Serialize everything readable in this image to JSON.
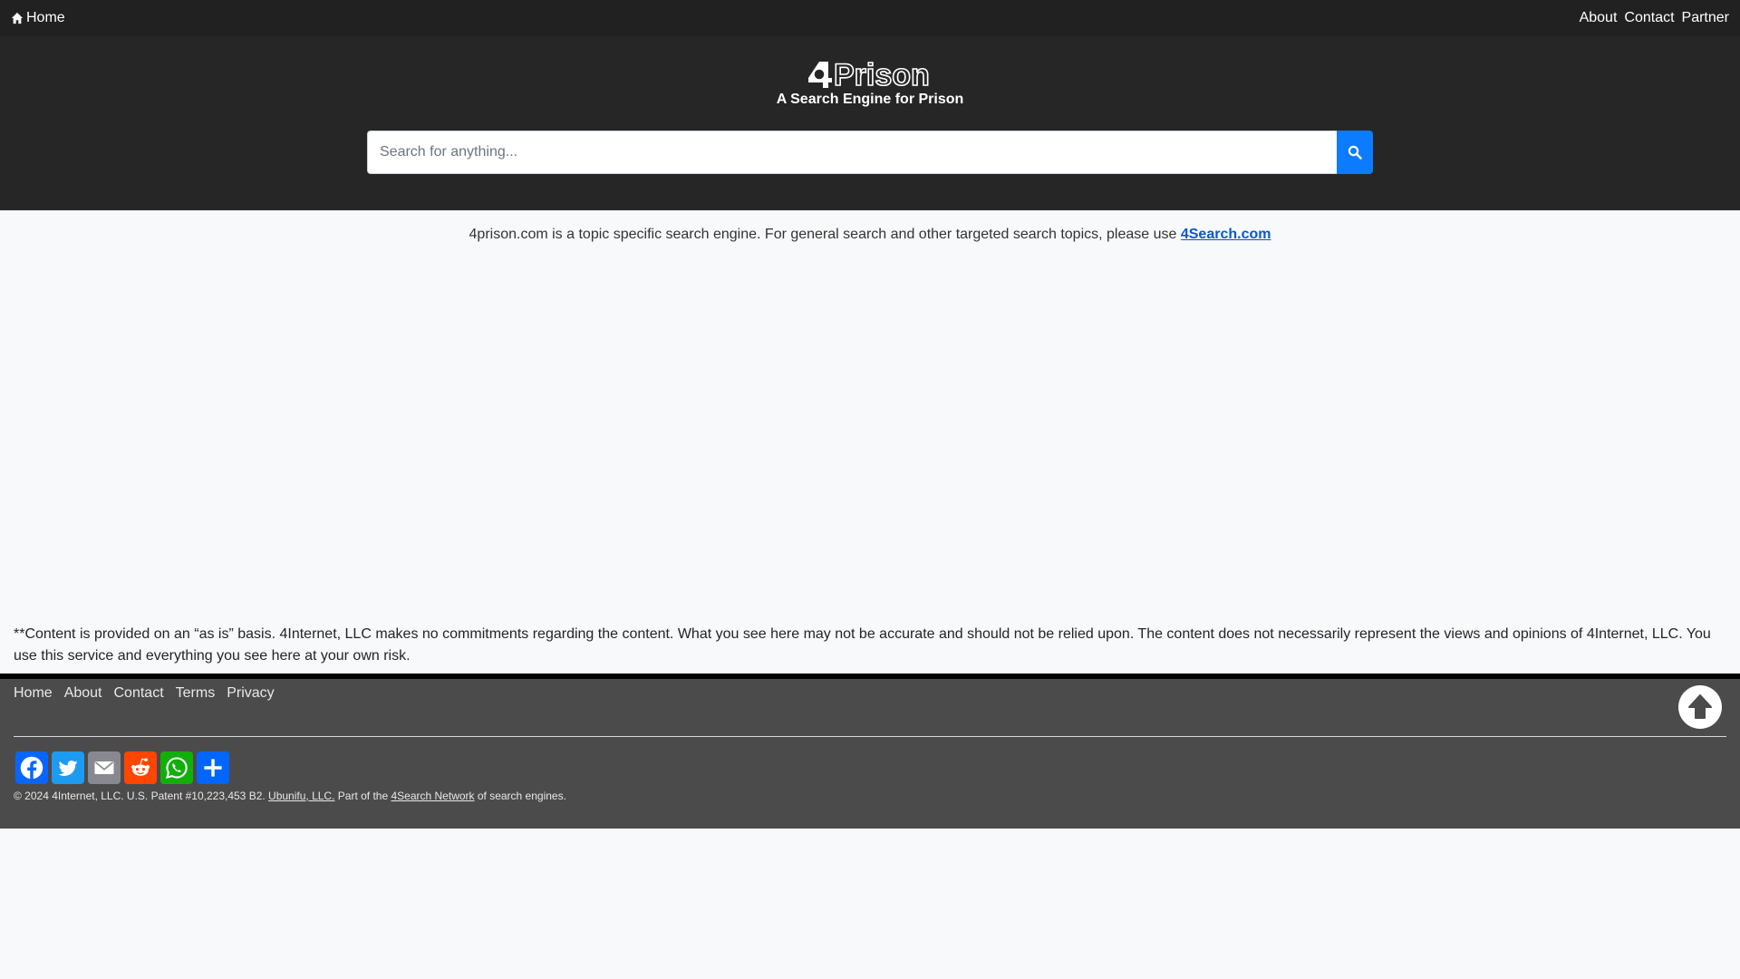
{
  "topnav": {
    "home_label": "Home",
    "right_links": [
      {
        "label": "About"
      },
      {
        "label": "Contact"
      },
      {
        "label": "Partner"
      }
    ]
  },
  "header": {
    "logo_text": "Prison",
    "logo_prefix": "4",
    "tagline": "A Search Engine for Prison"
  },
  "search": {
    "placeholder": "Search for anything...",
    "value": "",
    "button_icon": "search-icon"
  },
  "notice": {
    "text": "4prison.com is a topic specific search engine. For general search and other targeted search topics, please use ",
    "link_label": "4Search.com"
  },
  "disclaimer": {
    "text": "**Content is provided on an “as is” basis. 4Internet, LLC makes no commitments regarding the content. What you see here may not be accurate and should not be relied upon. The content does not necessarily represent the views and opinions of 4Internet, LLC. You use this service and everything you see here at your own risk."
  },
  "footer": {
    "links": [
      {
        "label": "Home"
      },
      {
        "label": "About"
      },
      {
        "label": "Contact"
      },
      {
        "label": "Terms"
      },
      {
        "label": "Privacy"
      }
    ],
    "to_top_icon": "arrow-up-icon",
    "share": [
      {
        "name": "facebook",
        "color": "#0866ff"
      },
      {
        "name": "twitter",
        "color": "#1d9bf0"
      },
      {
        "name": "email",
        "color": "#888990"
      },
      {
        "name": "reddit",
        "color": "#ff4500"
      },
      {
        "name": "whatsapp",
        "color": "#12af0a"
      },
      {
        "name": "share",
        "color": "#0166ff"
      }
    ],
    "copyright_prefix": "© 2024 4Internet, LLC. U.S. Patent #10,223,453 B2. ",
    "company_link": "Ubunifu, LLC.",
    "copyright_mid": " Part of the ",
    "network_link": "4Search Network",
    "copyright_suffix": " of search engines."
  },
  "colors": {
    "topnav_bg": "#212121",
    "hero_bg": "#262626",
    "accent": "#0d7bfe",
    "footer_bg": "#4b4b4b",
    "page_bg": "#f8f9fb"
  }
}
